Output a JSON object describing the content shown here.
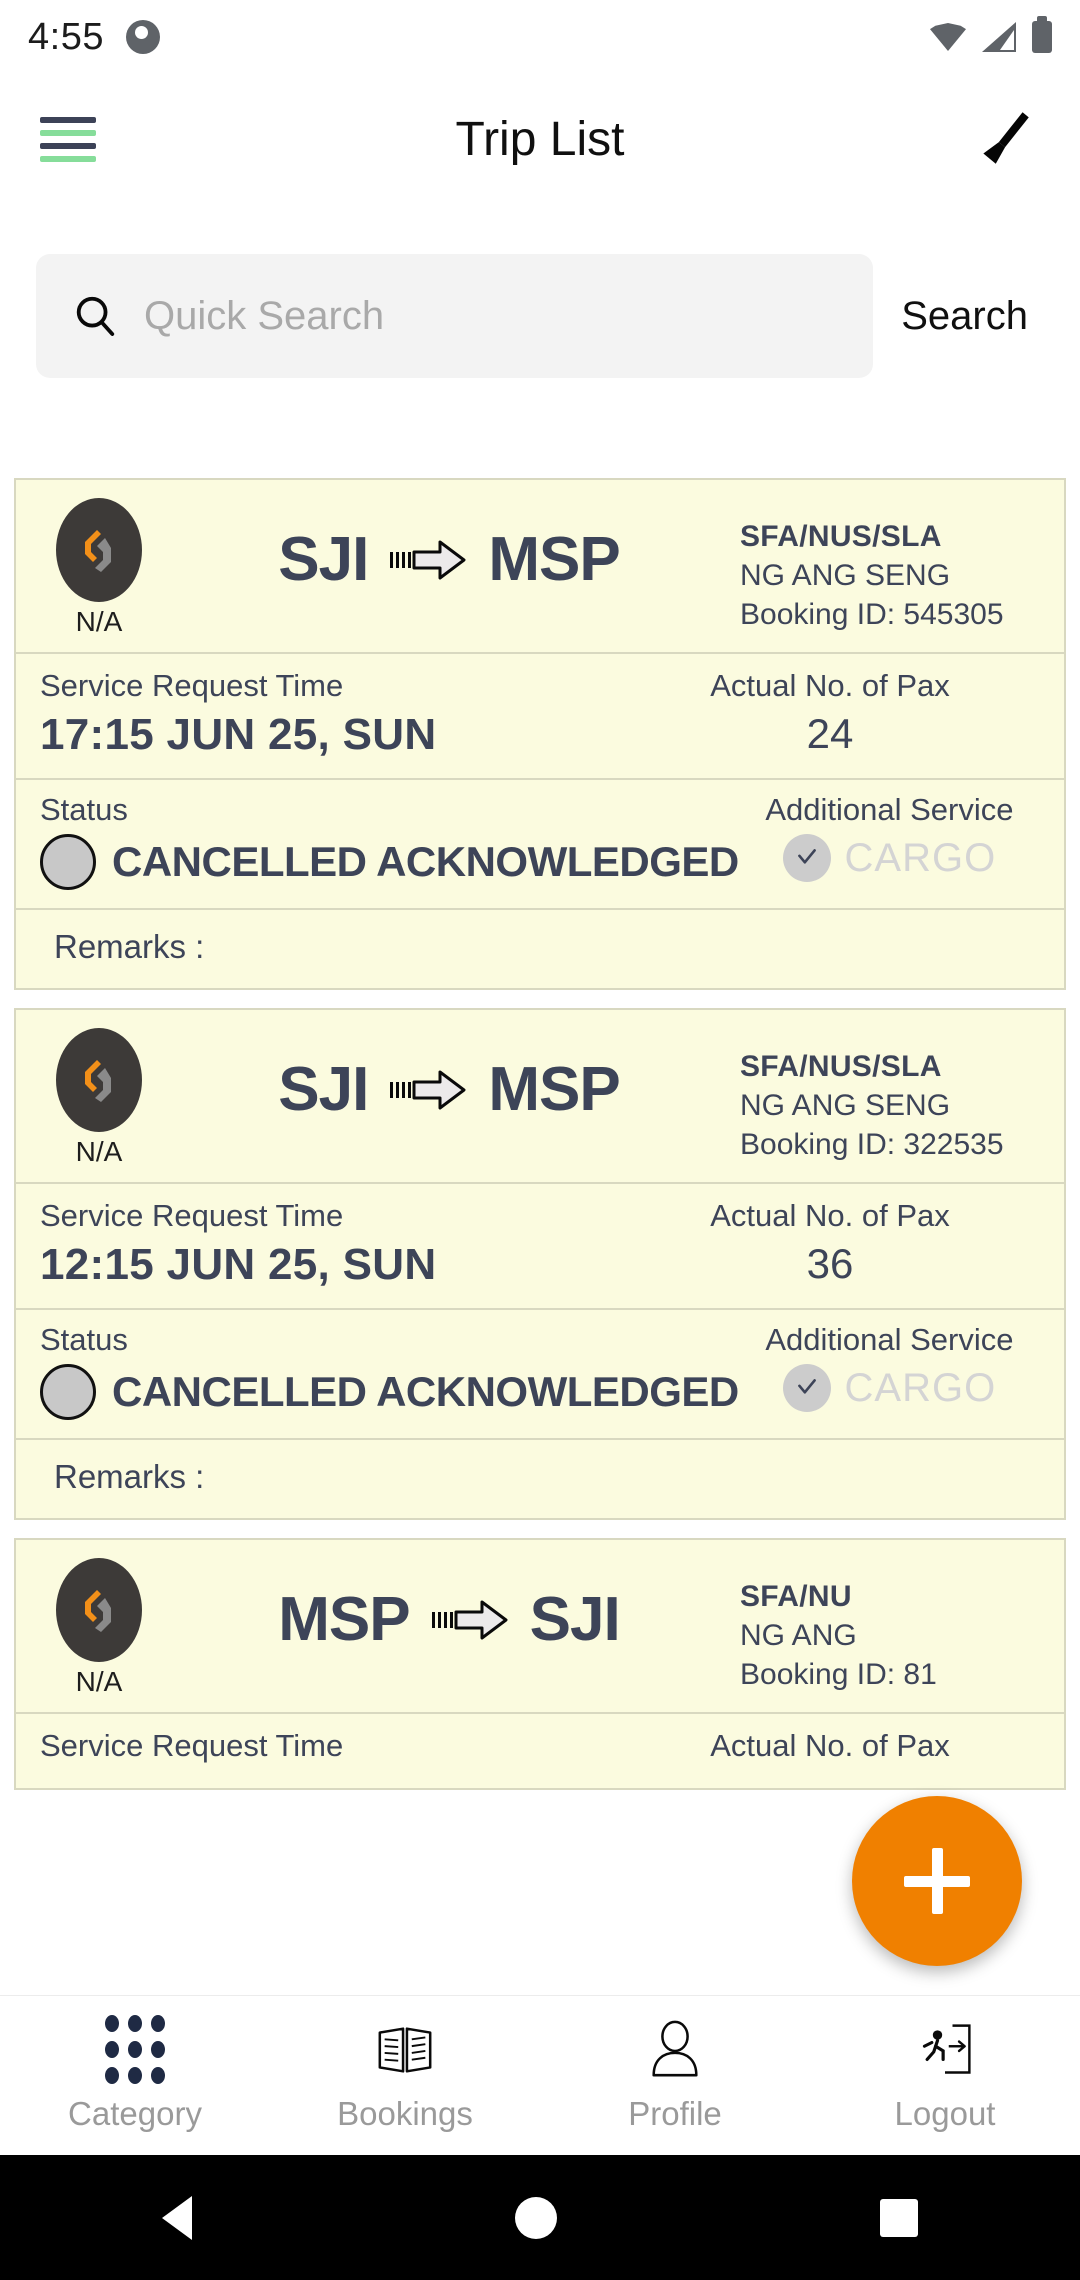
{
  "status_bar": {
    "time": "4:55",
    "icons": [
      "notification-dot-icon",
      "wifi-icon",
      "signal-icon",
      "battery-icon"
    ]
  },
  "app_bar": {
    "menu_icon": "hamburger-menu-icon",
    "title": "Trip List",
    "action_icon": "broom-clear-icon"
  },
  "search": {
    "icon": "search-icon",
    "placeholder": "Quick Search",
    "value": "",
    "button_label": "Search"
  },
  "labels": {
    "service_request_time": "Service Request Time",
    "actual_no_of_pax": "Actual No. of Pax",
    "status": "Status",
    "additional_service": "Additional Service",
    "remarks": "Remarks :",
    "logo_caption": "N/A"
  },
  "trips": [
    {
      "origin": "SJI",
      "destination": "MSP",
      "logo_caption": "N/A",
      "company_code": "SFA/NUS/SLA",
      "customer_name": "NG ANG SENG",
      "booking_id": "Booking ID: 545305",
      "service_request_time": "17:15 JUN 25, SUN",
      "actual_no_of_pax": "24",
      "status": "CANCELLED ACKNOWLEDGED",
      "additional_service": "CARGO",
      "remarks": "Remarks :"
    },
    {
      "origin": "SJI",
      "destination": "MSP",
      "logo_caption": "N/A",
      "company_code": "SFA/NUS/SLA",
      "customer_name": "NG ANG SENG",
      "booking_id": "Booking ID: 322535",
      "service_request_time": "12:15 JUN 25, SUN",
      "actual_no_of_pax": "36",
      "status": "CANCELLED ACKNOWLEDGED",
      "additional_service": "CARGO",
      "remarks": "Remarks :"
    },
    {
      "origin": "MSP",
      "destination": "SJI",
      "logo_caption": "N/A",
      "company_code": "SFA/NU",
      "customer_name": "NG ANG",
      "booking_id": "Booking ID: 81",
      "service_request_time": "",
      "actual_no_of_pax": "",
      "status": "",
      "additional_service": "",
      "remarks": ""
    }
  ],
  "fab": {
    "icon": "plus-icon",
    "color": "#f08000"
  },
  "bottom_nav": [
    {
      "icon": "grid-dots-icon",
      "label": "Category"
    },
    {
      "icon": "open-book-icon",
      "label": "Bookings"
    },
    {
      "icon": "person-icon",
      "label": "Profile"
    },
    {
      "icon": "logout-run-door-icon",
      "label": "Logout"
    }
  ],
  "system_nav": [
    "back-icon",
    "home-icon",
    "recents-icon"
  ],
  "colors": {
    "card_bg": "#fbfbdf",
    "card_border": "#d8d8c0",
    "text_primary": "#3d4458",
    "accent_orange": "#f08000",
    "accent_green": "#86dd9a",
    "muted": "#9a9a9a"
  }
}
